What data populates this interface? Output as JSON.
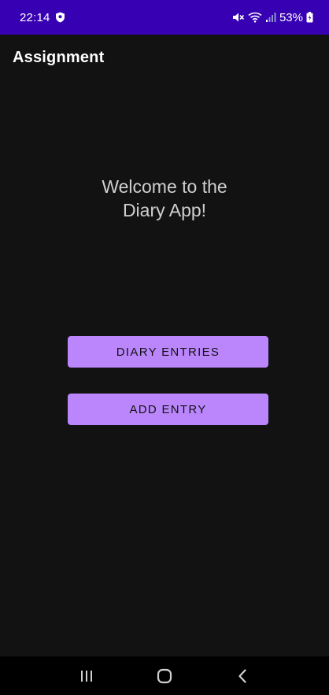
{
  "status_bar": {
    "time": "22:14",
    "battery": "53%",
    "icons": [
      "shield-icon",
      "mute-icon",
      "wifi-icon",
      "signal-icon",
      "battery-icon"
    ],
    "background_color": "#3700B3"
  },
  "app_bar": {
    "title": "Assignment"
  },
  "main": {
    "welcome_line1": "Welcome to the",
    "welcome_line2": "Diary App!",
    "diary_entries_label": "DIARY ENTRIES",
    "add_entry_label": "ADD ENTRY",
    "accent_color": "#BB86FC",
    "background_color": "#121212"
  },
  "nav_bar": {
    "icons": [
      "recent-apps-icon",
      "home-icon",
      "back-icon"
    ]
  }
}
